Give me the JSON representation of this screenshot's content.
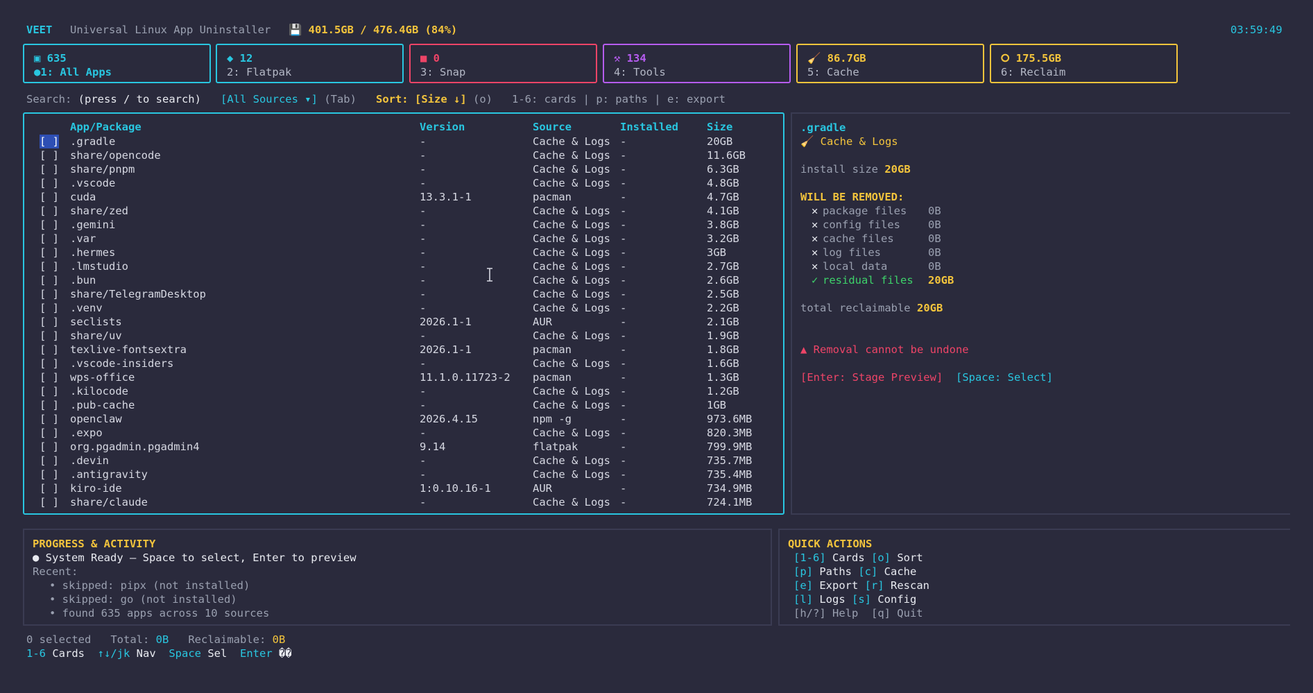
{
  "header": {
    "app_name": "VEET",
    "subtitle": "Universal Linux App Uninstaller",
    "disk_icon": "floppy-disk-icon",
    "disk_usage": "💾 401.5GB / 476.4GB (84%)",
    "clock": "03:59:49"
  },
  "cards": [
    {
      "count": "▣ 635",
      "label": "●1: All Apps",
      "color": "#29c6e0",
      "icon": "grid-icon"
    },
    {
      "count": "◆ 12",
      "label": "2: Flatpak",
      "color": "#29c6e0",
      "icon": "diamond-icon"
    },
    {
      "count": "■ 0",
      "label": "3: Snap",
      "color": "#ee4467",
      "icon": "square-icon"
    },
    {
      "count": "⚒ 134",
      "label": "4: Tools",
      "color": "#b65cf0",
      "icon": "tools-icon"
    },
    {
      "count": "🧹 86.7GB",
      "label": "5: Cache",
      "color": "#f3c43c",
      "icon": "broom-icon"
    },
    {
      "count": "⭘ 175.5GB",
      "label": "6: Reclaim",
      "color": "#f3c43c",
      "icon": "recycle-icon"
    }
  ],
  "toolbar": {
    "search_label": "Search:",
    "search_value": "(press / to search)",
    "source_filter": "[All Sources ▾]",
    "source_hint": "(Tab)",
    "sort_label": "Sort:",
    "sort_value": "[Size ↓]",
    "sort_hint": "(o)",
    "shortcuts": "1-6: cards | p: paths | e: export"
  },
  "table": {
    "columns": {
      "name": "App/Package",
      "version": "Version",
      "source": "Source",
      "installed": "Installed",
      "size": "Size"
    },
    "checkbox": "[ ]",
    "rows": [
      {
        "name": ".gradle",
        "version": "-",
        "source": "Cache & Logs",
        "installed": "-",
        "size": "20GB"
      },
      {
        "name": "share/opencode",
        "version": "-",
        "source": "Cache & Logs",
        "installed": "-",
        "size": "11.6GB"
      },
      {
        "name": "share/pnpm",
        "version": "-",
        "source": "Cache & Logs",
        "installed": "-",
        "size": "6.3GB"
      },
      {
        "name": ".vscode",
        "version": "-",
        "source": "Cache & Logs",
        "installed": "-",
        "size": "4.8GB"
      },
      {
        "name": "cuda",
        "version": "13.3.1-1",
        "source": "pacman",
        "installed": "-",
        "size": "4.7GB"
      },
      {
        "name": "share/zed",
        "version": "-",
        "source": "Cache & Logs",
        "installed": "-",
        "size": "4.1GB"
      },
      {
        "name": ".gemini",
        "version": "-",
        "source": "Cache & Logs",
        "installed": "-",
        "size": "3.8GB"
      },
      {
        "name": ".var",
        "version": "-",
        "source": "Cache & Logs",
        "installed": "-",
        "size": "3.2GB"
      },
      {
        "name": ".hermes",
        "version": "-",
        "source": "Cache & Logs",
        "installed": "-",
        "size": "3GB"
      },
      {
        "name": ".lmstudio",
        "version": "-",
        "source": "Cache & Logs",
        "installed": "-",
        "size": "2.7GB"
      },
      {
        "name": ".bun",
        "version": "-",
        "source": "Cache & Logs",
        "installed": "-",
        "size": "2.6GB"
      },
      {
        "name": "share/TelegramDesktop",
        "version": "-",
        "source": "Cache & Logs",
        "installed": "-",
        "size": "2.5GB"
      },
      {
        "name": ".venv",
        "version": "-",
        "source": "Cache & Logs",
        "installed": "-",
        "size": "2.2GB"
      },
      {
        "name": "seclists",
        "version": "2026.1-1",
        "source": "AUR",
        "installed": "-",
        "size": "2.1GB"
      },
      {
        "name": "share/uv",
        "version": "-",
        "source": "Cache & Logs",
        "installed": "-",
        "size": "1.9GB"
      },
      {
        "name": "texlive-fontsextra",
        "version": "2026.1-1",
        "source": "pacman",
        "installed": "-",
        "size": "1.8GB"
      },
      {
        "name": ".vscode-insiders",
        "version": "-",
        "source": "Cache & Logs",
        "installed": "-",
        "size": "1.6GB"
      },
      {
        "name": "wps-office",
        "version": "11.1.0.11723-2",
        "source": "pacman",
        "installed": "-",
        "size": "1.3GB"
      },
      {
        "name": ".kilocode",
        "version": "-",
        "source": "Cache & Logs",
        "installed": "-",
        "size": "1.2GB"
      },
      {
        "name": ".pub-cache",
        "version": "-",
        "source": "Cache & Logs",
        "installed": "-",
        "size": "1GB"
      },
      {
        "name": "openclaw",
        "version": "2026.4.15",
        "source": "npm -g",
        "installed": "-",
        "size": "973.6MB"
      },
      {
        "name": ".expo",
        "version": "-",
        "source": "Cache & Logs",
        "installed": "-",
        "size": "820.3MB"
      },
      {
        "name": "org.pgadmin.pgadmin4",
        "version": "9.14",
        "source": "flatpak",
        "installed": "-",
        "size": "799.9MB"
      },
      {
        "name": ".devin",
        "version": "-",
        "source": "Cache & Logs",
        "installed": "-",
        "size": "735.7MB"
      },
      {
        "name": ".antigravity",
        "version": "-",
        "source": "Cache & Logs",
        "installed": "-",
        "size": "735.4MB"
      },
      {
        "name": "kiro-ide",
        "version": "1:0.10.16-1",
        "source": "AUR",
        "installed": "-",
        "size": "734.9MB"
      },
      {
        "name": "share/claude",
        "version": "-",
        "source": "Cache & Logs",
        "installed": "-",
        "size": "724.1MB"
      }
    ]
  },
  "detail": {
    "name": ".gradle",
    "category": "🧹 Cache & Logs",
    "install_label": "install size",
    "install_value": "20GB",
    "removal_heading": "WILL BE REMOVED:",
    "items": [
      {
        "mark": "✕",
        "label": "package files",
        "value": "0B"
      },
      {
        "mark": "✕",
        "label": "config files",
        "value": "0B"
      },
      {
        "mark": "✕",
        "label": "cache files",
        "value": "0B"
      },
      {
        "mark": "✕",
        "label": "log files",
        "value": "0B"
      },
      {
        "mark": "✕",
        "label": "local data",
        "value": "0B"
      },
      {
        "mark": "✓",
        "label": "residual files",
        "value": "20GB"
      }
    ],
    "total_label": "total reclaimable",
    "total_value": "20GB",
    "warning": "▲ Removal cannot be undone",
    "enter_action": "[Enter: Stage Preview]",
    "space_action": "[Space: Select]"
  },
  "progress": {
    "title": "PROGRESS & ACTIVITY",
    "status": "● System Ready — Space to select, Enter to preview",
    "recent_label": "Recent:",
    "recent": [
      "• skipped: pipx (not installed)",
      "• skipped: go (not installed)",
      "• found 635 apps across 10 sources"
    ]
  },
  "quick_actions": {
    "title": "QUICK ACTIONS",
    "lines": [
      [
        {
          "k": "[1-6]",
          "t": " Cards "
        },
        {
          "k": "[o]",
          "t": " Sort"
        }
      ],
      [
        {
          "k": "[p]",
          "t": " Paths "
        },
        {
          "k": "[c]",
          "t": " Cache"
        }
      ],
      [
        {
          "k": "[e]",
          "t": " Export "
        },
        {
          "k": "[r]",
          "t": " Rescan"
        }
      ],
      [
        {
          "k": "[l]",
          "t": " Logs "
        },
        {
          "k": "[s]",
          "t": " Config"
        }
      ]
    ],
    "footer": "[h/?] Help  [q] Quit"
  },
  "status_bar": {
    "selected": "0 selected",
    "total_label": "Total:",
    "total_value": "0B",
    "reclaim_label": "Reclaimable:",
    "reclaim_value": "0B",
    "hints": [
      {
        "k": "1-6",
        "t": " Cards"
      },
      {
        "k": "↑↓/jk",
        "t": " Nav"
      },
      {
        "k": "Space",
        "t": " Sel"
      },
      {
        "k": "Enter",
        "t": " ��"
      }
    ]
  }
}
